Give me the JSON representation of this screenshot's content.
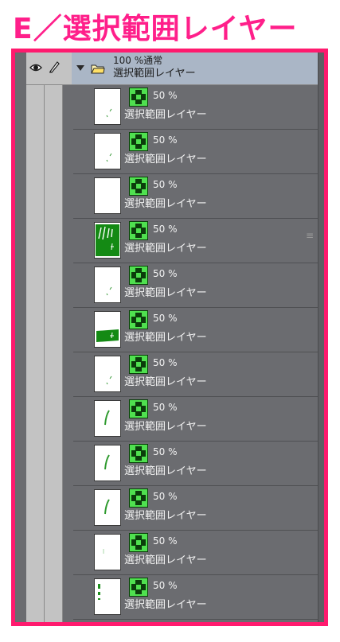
{
  "heading": "E／選択範囲レイヤー",
  "folder": {
    "blend": "100 %通常",
    "name": "選択範囲レイヤー"
  },
  "layers": [
    {
      "opacity": "50 %",
      "name": "選択範囲レイヤー",
      "thumb": "small-mark"
    },
    {
      "opacity": "50 %",
      "name": "選択範囲レイヤー",
      "thumb": "small-mark"
    },
    {
      "opacity": "50 %",
      "name": "選択範囲レイヤー",
      "thumb": "blank"
    },
    {
      "opacity": "50 %",
      "name": "選択範囲レイヤー",
      "thumb": "green-full"
    },
    {
      "opacity": "50 %",
      "name": "選択範囲レイヤー",
      "thumb": "small-mark"
    },
    {
      "opacity": "50 %",
      "name": "選択範囲レイヤー",
      "thumb": "green-band"
    },
    {
      "opacity": "50 %",
      "name": "選択範囲レイヤー",
      "thumb": "small-mark"
    },
    {
      "opacity": "50 %",
      "name": "選択範囲レイヤー",
      "thumb": "stroke"
    },
    {
      "opacity": "50 %",
      "name": "選択範囲レイヤー",
      "thumb": "stroke"
    },
    {
      "opacity": "50 %",
      "name": "選択範囲レイヤー",
      "thumb": "stroke"
    },
    {
      "opacity": "50 %",
      "name": "選択範囲レイヤー",
      "thumb": "faint"
    },
    {
      "opacity": "50 %",
      "name": "選択範囲レイヤー",
      "thumb": "dots"
    }
  ],
  "colors": {
    "heading": "#ff1f8a",
    "frame": "#ff1a6e",
    "panel": "#6b6c70",
    "selected_folder": "#aab6c6",
    "mask_green": "#33cc33"
  },
  "icons": {
    "visibility": "eye-icon",
    "lock": "pen-icon",
    "expand": "triangle-down-icon",
    "folder": "folder-icon",
    "mask": "selection-mask-icon"
  }
}
